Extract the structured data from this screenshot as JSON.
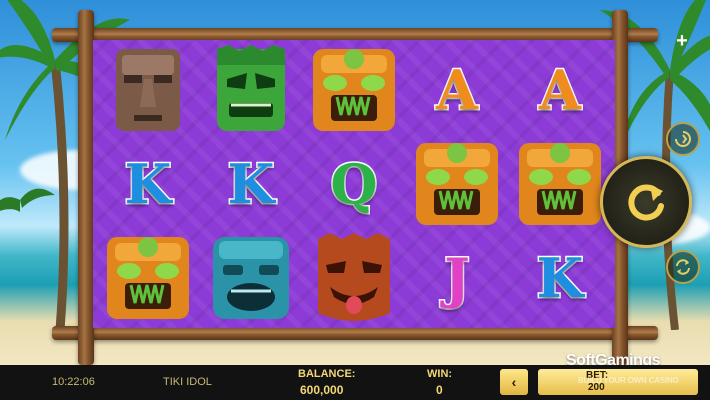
{
  "game": {
    "title": "TIKI IDOL",
    "clock": "10:22:06"
  },
  "reels": [
    [
      "moai-idol",
      "blue-k",
      "gold-tiki"
    ],
    [
      "green-tiki",
      "blue-k",
      "blue-tiki"
    ],
    [
      "gold-tiki",
      "green-q",
      "red-tiki"
    ],
    [
      "orange-a",
      "gold-tiki",
      "pink-j"
    ],
    [
      "orange-a",
      "gold-tiki",
      "blue-k"
    ]
  ],
  "letters": {
    "a": "A",
    "k": "K",
    "q": "Q",
    "j": "J"
  },
  "status": {
    "balance_label": "BALANCE:",
    "balance_value": "600,000",
    "win_label": "WIN:",
    "win_value": "0",
    "bet_label": "BET:",
    "bet_value": "200",
    "prev_symbol": "‹"
  },
  "controls": {
    "plus_symbol": "+"
  },
  "watermark": {
    "brand": "SoftGamings",
    "tagline": "BUILD YOUR OWN CASINO"
  },
  "colors": {
    "board": "#8c3bd6",
    "letter_a": "#f08b1e",
    "letter_k": "#1e8fe0",
    "letter_q": "#2bb34a",
    "letter_j": "#e340c8",
    "bar_text": "#f1d776"
  }
}
